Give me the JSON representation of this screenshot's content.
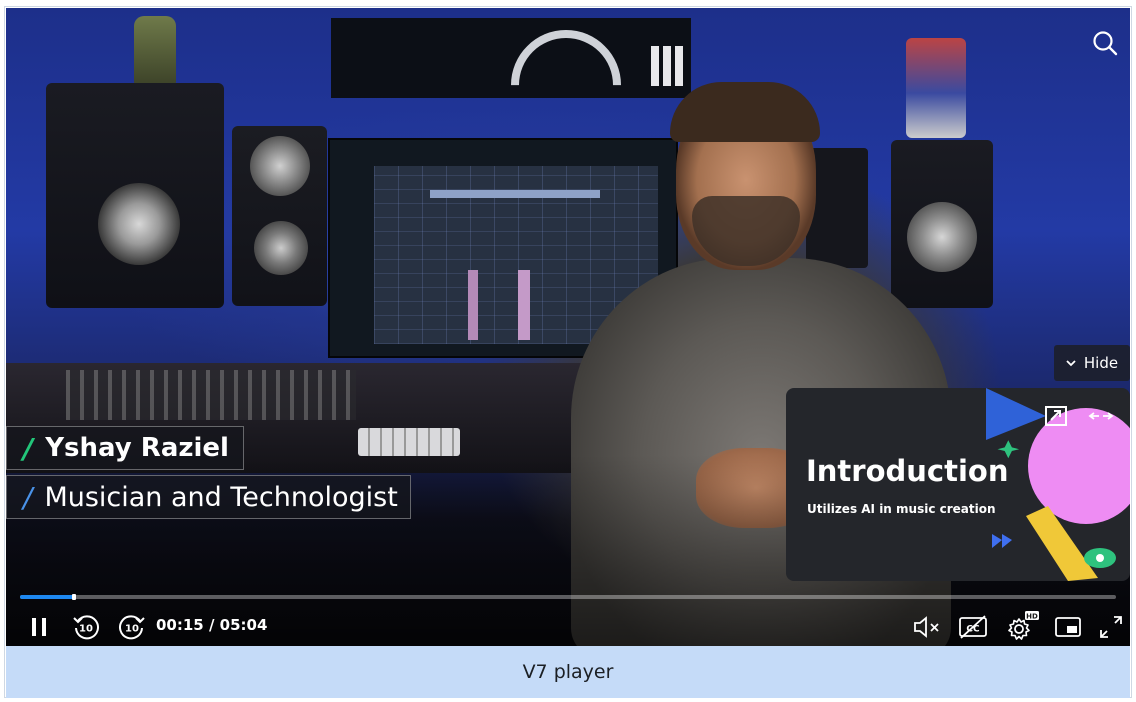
{
  "lower_third": {
    "name": "Yshay Raziel",
    "role": "Musician and Technologist",
    "slash": "/",
    "slash_colors": {
      "name": "#22c67a",
      "role": "#4a92e8"
    }
  },
  "top_bar": {
    "search_icon": "search-icon"
  },
  "chapters": {
    "hide_label": "Hide",
    "card": {
      "title": "Introduction",
      "subtitle": "Utilizes AI in music creation"
    }
  },
  "playback": {
    "current_time": "00:15",
    "duration": "05:04",
    "time_display": "00:15 / 05:04",
    "progress_fraction": 0.049,
    "skip_back_label": "10",
    "skip_forward_label": "10",
    "settings_badge": "HD",
    "state": "playing"
  },
  "controls_icons": [
    "pause-icon",
    "rewind-10-icon",
    "forward-10-icon",
    "mute-icon",
    "captions-off-icon",
    "settings-icon",
    "picture-in-picture-icon",
    "fullscreen-icon"
  ],
  "colors": {
    "accent": "#1e88f0",
    "caption_bar": "#c5dbf8"
  },
  "caption": {
    "text": "V7 player"
  }
}
